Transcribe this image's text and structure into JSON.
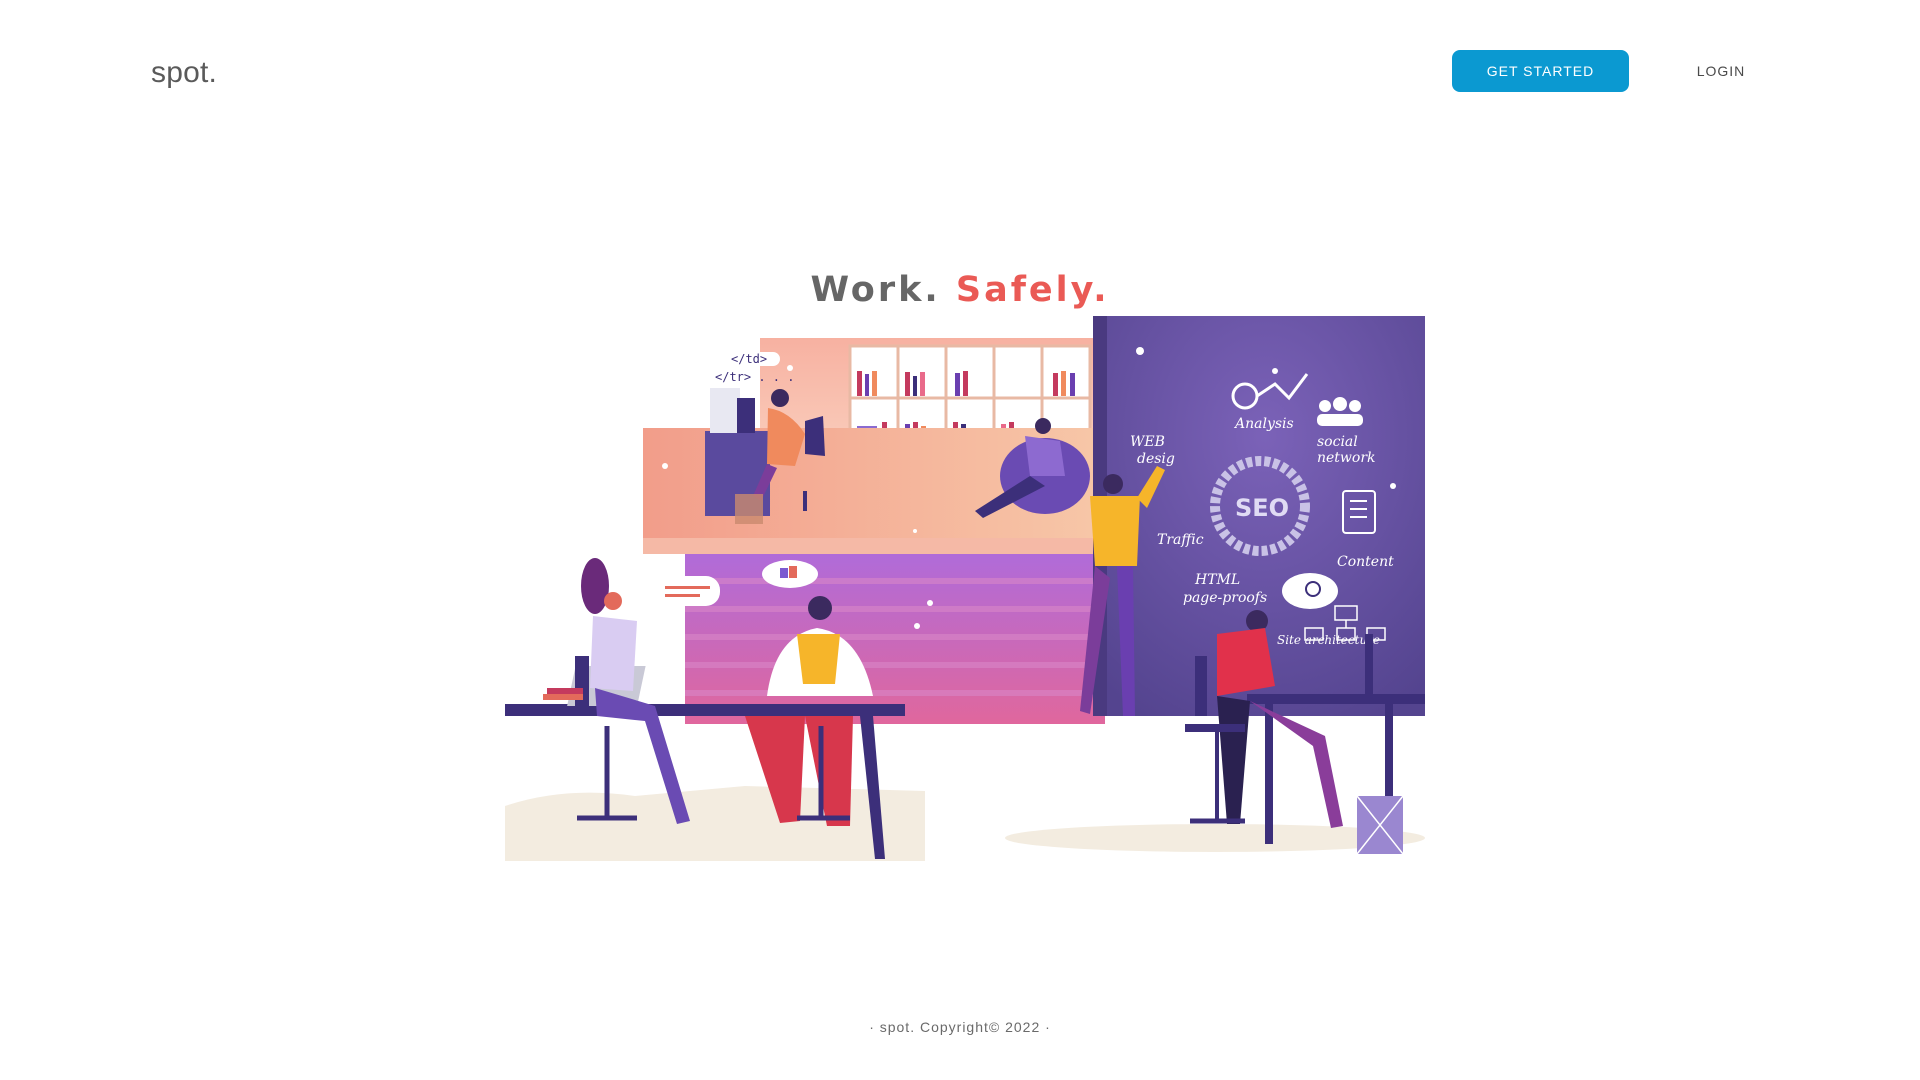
{
  "header": {
    "logo": "spot.",
    "get_started_label": "GET STARTED",
    "login_label": "LOGIN"
  },
  "hero": {
    "title_part1": "Work.",
    "title_part2": "Safely."
  },
  "illustration": {
    "code_bubble_line1": "</td>",
    "code_bubble_line2": "</tr> . . .",
    "board_labels": {
      "web_design": [
        "WEB",
        "desig"
      ],
      "analysis": "Analysis",
      "social_network": [
        "social",
        "network"
      ],
      "seo": "SEO",
      "traffic": "Traffic",
      "content": "Content",
      "html_proofs": [
        "HTML",
        "page-proofs"
      ],
      "site_architecture": "Site architecture"
    }
  },
  "footer": {
    "copyright": "· spot. Copyright© 2022 ·"
  },
  "colors": {
    "accent": "#0b99d1",
    "title_gray": "#666666",
    "title_red": "#ea5a55",
    "board_purple": "#5c4a95"
  }
}
